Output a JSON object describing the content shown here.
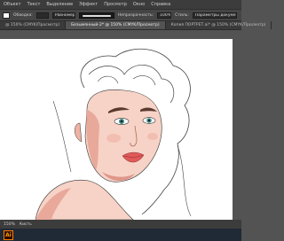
{
  "menu": {
    "items": [
      "Объект",
      "Текст",
      "Выделение",
      "Эффект",
      "Просмотр",
      "Окно",
      "Справка"
    ]
  },
  "control": {
    "stroke_label": "Обводка:",
    "stroke_value": "",
    "style_label": "Равномерный",
    "opacity_label": "Непрозрачность:",
    "opacity_value": "100%",
    "style_btn": "Стиль:",
    "transform_btn": "Параметры документа"
  },
  "tabs": [
    {
      "label": "@ 150% (CMYK/Просмотр)"
    },
    {
      "label": "Безымянный-2* @ 150% (CMYK/Просмотр)"
    },
    {
      "label": "Копия ПОРТРЕТ.ai* @ 150% (CMYK/Просмотр)"
    }
  ],
  "status": {
    "zoom": "150%",
    "tool": "Кисть"
  },
  "taskbar": {
    "app_icon": "Ai"
  },
  "colors": {
    "ui_dark": "#3c3c3c",
    "ui_mid": "#535353",
    "skin_light": "#f6d3c6",
    "skin_shadow": "#e8a89a",
    "lips": "#e05a5a",
    "eyes": "#3d8a86",
    "brows": "#5a3a2f",
    "accent": "#ff7c00"
  }
}
